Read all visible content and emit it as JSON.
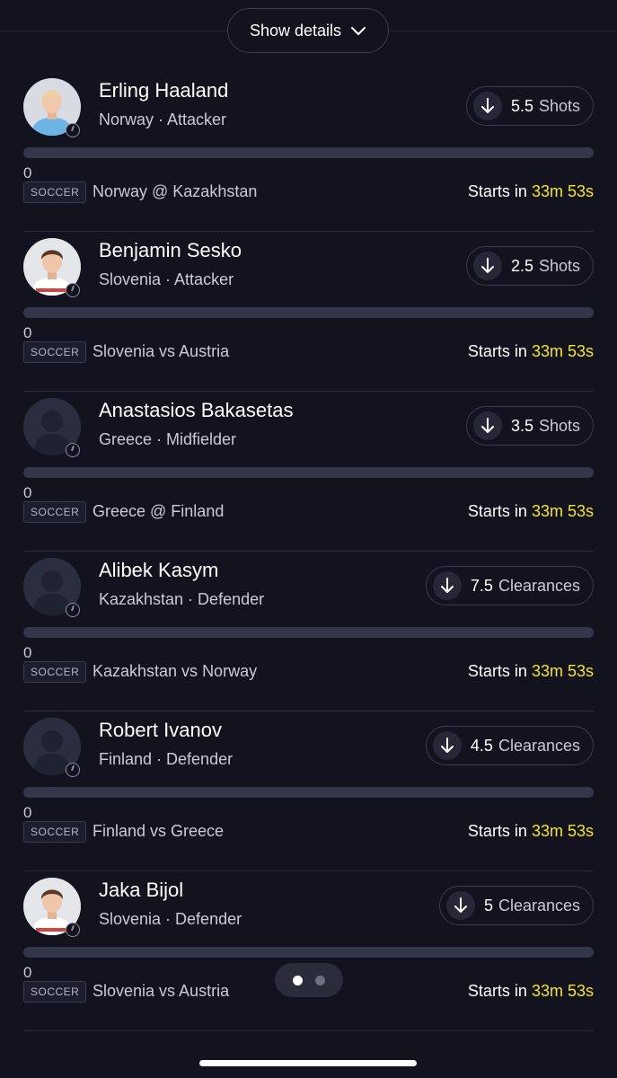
{
  "header": {
    "show_details_label": "Show details"
  },
  "cards": [
    {
      "name": "Erling Haaland",
      "meta": "Norway · Attacker",
      "prop_value": "5.5",
      "prop_stat": "Shots",
      "progress": "0",
      "sport": "SOCCER",
      "matchup": "Norway  @ Kazakhstan",
      "starts_label": "Starts in ",
      "starts_time": "33m 53s",
      "avatar": "photo-blue-kit"
    },
    {
      "name": "Benjamin Sesko",
      "meta": "Slovenia · Attacker",
      "prop_value": "2.5",
      "prop_stat": "Shots",
      "progress": "0",
      "sport": "SOCCER",
      "matchup": "Slovenia  vs Austria",
      "starts_label": "Starts in ",
      "starts_time": "33m 53s",
      "avatar": "photo-white-kit"
    },
    {
      "name": "Anastasios Bakasetas",
      "meta": "Greece · Midfielder",
      "prop_value": "3.5",
      "prop_stat": "Shots",
      "progress": "0",
      "sport": "SOCCER",
      "matchup": "Greece  @ Finland",
      "starts_label": "Starts in ",
      "starts_time": "33m 53s",
      "avatar": "silhouette"
    },
    {
      "name": "Alibek Kasym",
      "meta": "Kazakhstan · Defender",
      "prop_value": "7.5",
      "prop_stat": "Clearances",
      "progress": "0",
      "sport": "SOCCER",
      "matchup": "Kazakhstan  vs Norway",
      "starts_label": "Starts in ",
      "starts_time": "33m 53s",
      "avatar": "silhouette"
    },
    {
      "name": "Robert Ivanov",
      "meta": "Finland · Defender",
      "prop_value": "4.5",
      "prop_stat": "Clearances",
      "progress": "0",
      "sport": "SOCCER",
      "matchup": "Finland  vs Greece",
      "starts_label": "Starts in ",
      "starts_time": "33m 53s",
      "avatar": "silhouette"
    },
    {
      "name": "Jaka Bijol",
      "meta": "Slovenia · Defender",
      "prop_value": "5",
      "prop_stat": "Clearances",
      "progress": "0",
      "sport": "SOCCER",
      "matchup": "Slovenia  vs Austria",
      "starts_label": "Starts in ",
      "starts_time": "33m 53s",
      "avatar": "photo-white-kit"
    }
  ],
  "pager": {
    "active_page": 1,
    "page_count": 2
  },
  "colors": {
    "background": "#12131f",
    "accent_time": "#f5e52a",
    "pill_border": "#3a3d4f",
    "progress_track": "#34374a"
  }
}
